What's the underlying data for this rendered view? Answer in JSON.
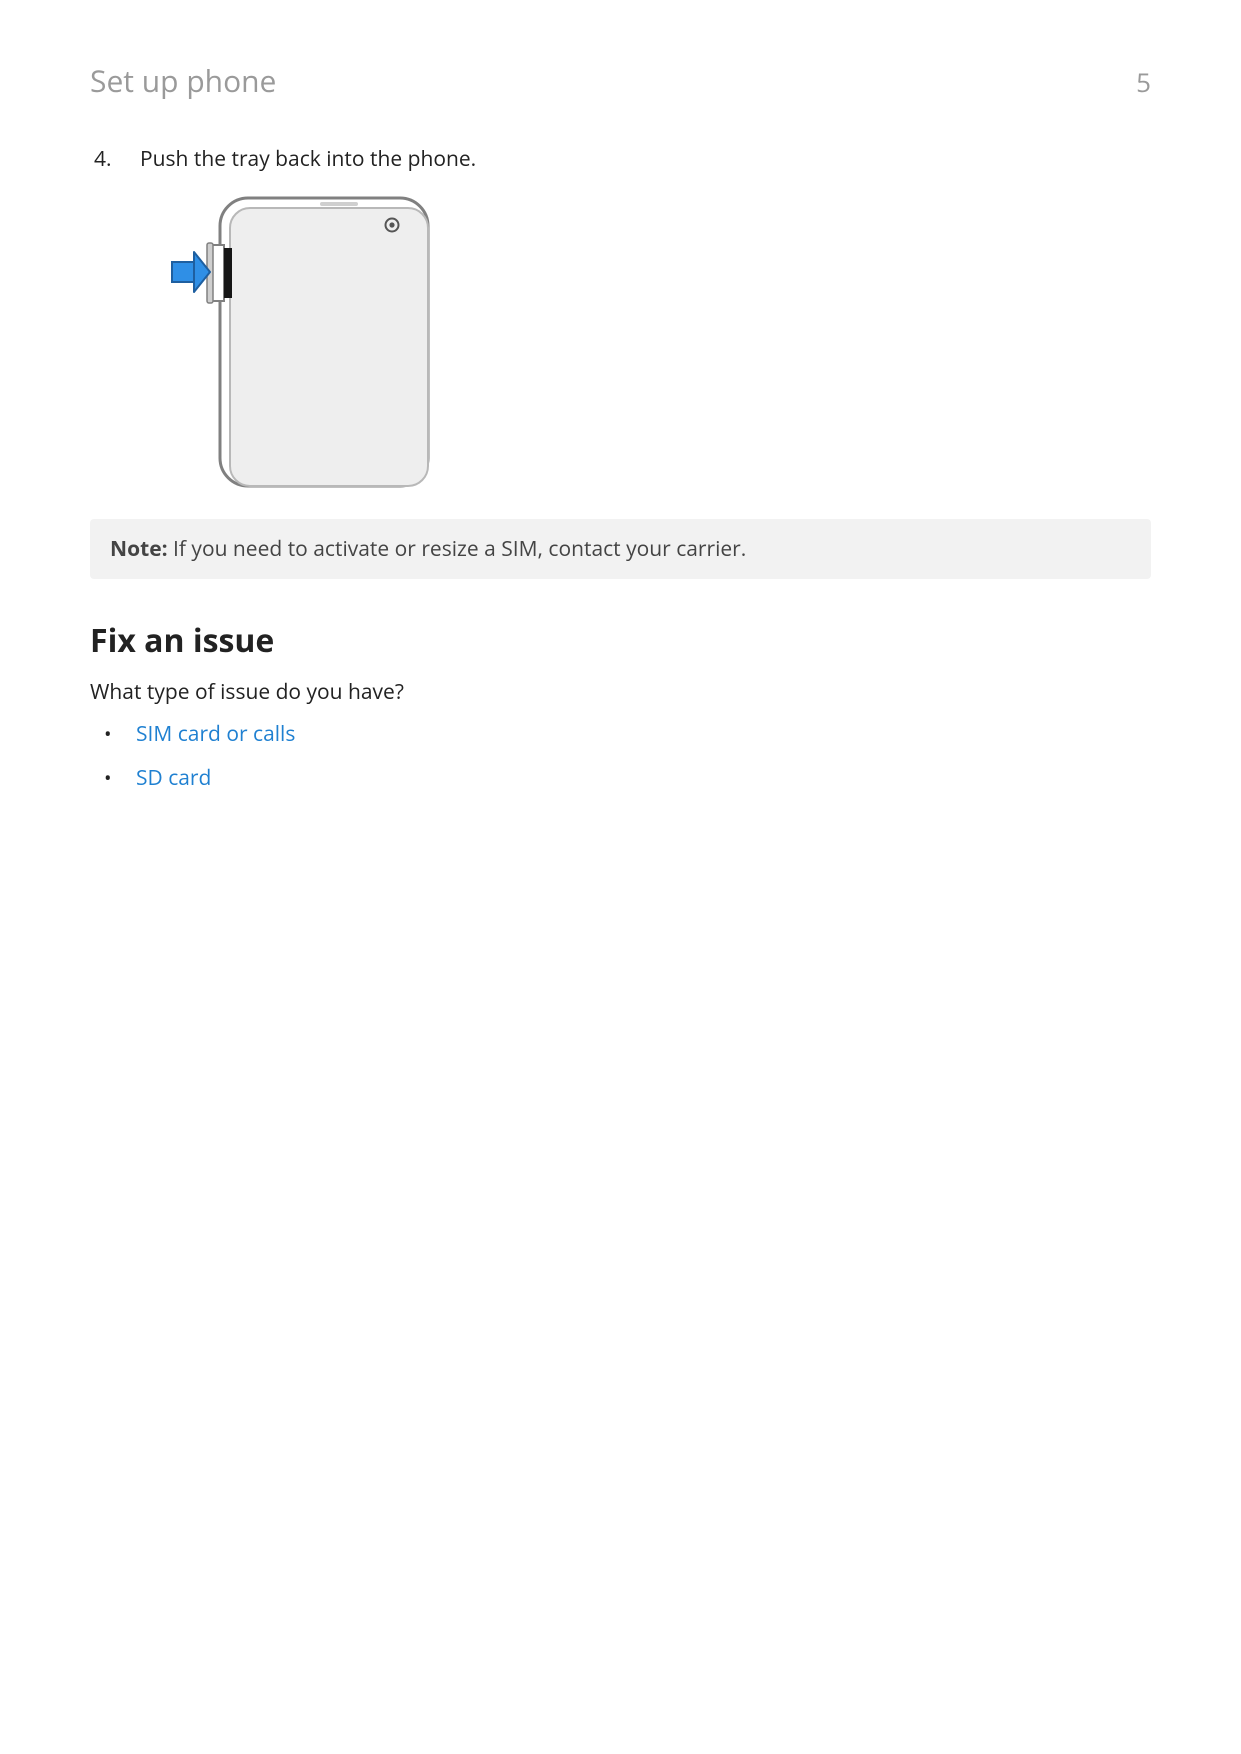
{
  "header": {
    "title": "Set up phone",
    "page_number": "5"
  },
  "step": {
    "number": "4.",
    "text": "Push the tray back into the phone."
  },
  "note": {
    "label": "Note:",
    "text": " If you need to activate or resize a SIM, contact your carrier."
  },
  "section": {
    "heading": "Fix an issue",
    "intro": "What type of issue do you have?",
    "links": [
      "SIM card or calls",
      "SD card"
    ]
  }
}
